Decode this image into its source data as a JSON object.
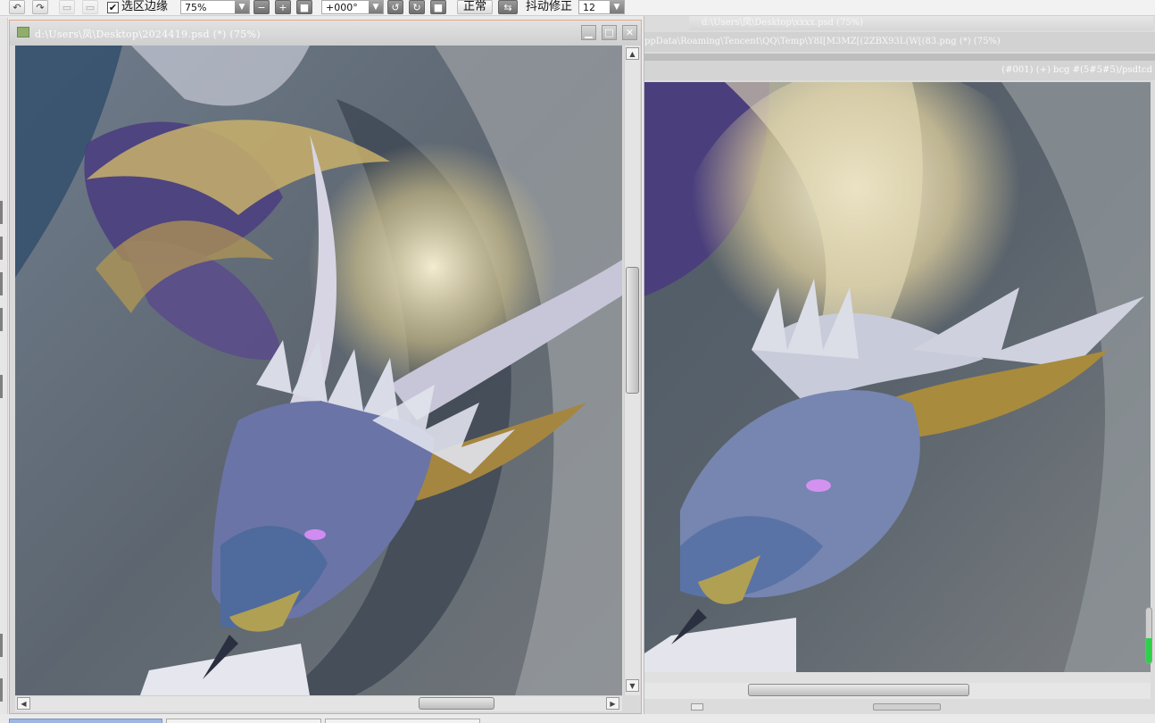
{
  "toolbar": {
    "undo_icon": "undo-icon",
    "redo_icon": "redo-icon",
    "selection_edge_label": "选区边缘",
    "selection_edge_checked": true,
    "zoom_value": "75%",
    "rotation_value": "+000°",
    "blend_mode_label": "正常",
    "stabilizer_label": "抖动修正",
    "stabilizer_value": "12"
  },
  "document": {
    "title": "d:\\Users\\凤\\Desktop\\2024419.psd (*) (75%)"
  },
  "reference": {
    "tab_title": "d:\\Users\\凤\\Desktop\\xxxx.psd (75%)",
    "path_title": "ppData\\Roaming\\Tencent\\QQ\\Temp\\Y8I[M3MZ[(2ZBX93L(W[(83.png (*) (75%)",
    "info_text": "(#001) (+) bcg #(5#5#5)/psdtcd",
    "slider_level_percent": 45
  },
  "colors": {
    "accent_border": "#e3a988",
    "slider_fill": "#2fcf4a",
    "active_tab": "#9fb6e2"
  }
}
